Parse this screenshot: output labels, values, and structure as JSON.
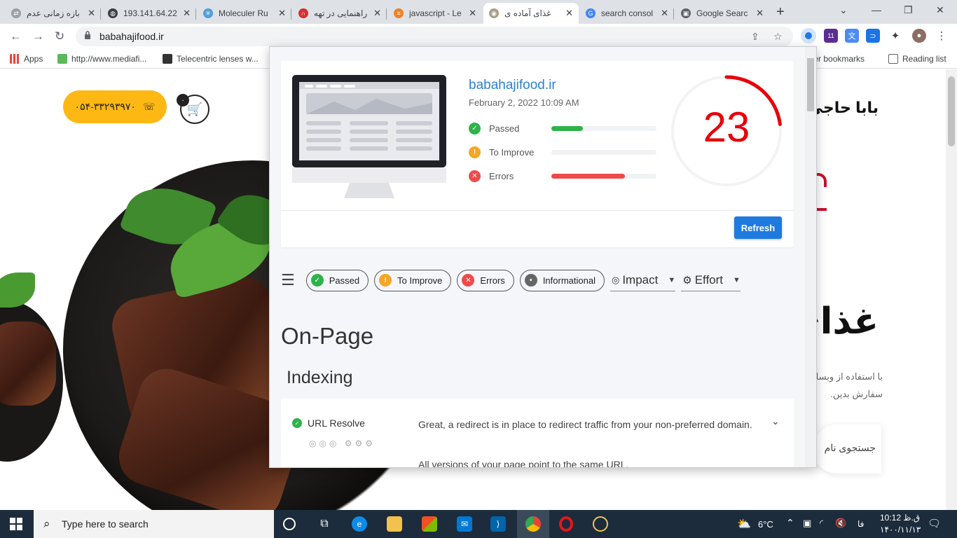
{
  "browser": {
    "tabs": [
      {
        "title": "بازه زمانی عدم",
        "color": "#5f6368"
      },
      {
        "title": "193.141.64.22",
        "color": "#5f6368"
      },
      {
        "title": "Moleculer Ru",
        "color": "#4e9fdc"
      },
      {
        "title": "راهنمایی در تهه",
        "color": "#d32f2f"
      },
      {
        "title": "javascript - Le",
        "color": "#f48024"
      },
      {
        "title": "غذای آماده ی",
        "color": "#a89f88"
      },
      {
        "title": "search consol",
        "color": "#4285f4"
      },
      {
        "title": "Google Searc",
        "color": "#5f6368"
      }
    ],
    "new_tab": "+",
    "url": "babahajifood.ir",
    "extension_badge": "11",
    "bookmarks": [
      {
        "label": "Apps"
      },
      {
        "label": "http://www.mediafi..."
      },
      {
        "label": "Telecentric lenses w..."
      }
    ],
    "other_bookmarks": "Other bookmarks",
    "reading_list": "Reading list"
  },
  "site": {
    "phone": "۰۵۴-۳۳۲۹۳۹۷۰",
    "cart_count": "۰",
    "brand": "بابا حاجی",
    "headline": "غذای",
    "desc_line1": "با استفاده از وبسا",
    "desc_line2": "سفارش بدین.",
    "search_placeholder": "جستجوی نام"
  },
  "report": {
    "site": "babahajifood.ir",
    "date": "February 2, 2022 10:09 AM",
    "score": "23",
    "score_fraction": 0.23,
    "stats": [
      {
        "label": "Passed",
        "fraction": 0.3,
        "color": "#2db34a",
        "icon": "check"
      },
      {
        "label": "To Improve",
        "fraction": 0.0,
        "color": "#f5a623",
        "icon": "!"
      },
      {
        "label": "Errors",
        "fraction": 0.7,
        "color": "#ef4a4a",
        "icon": "x"
      }
    ],
    "refresh_label": "Refresh",
    "filters": [
      {
        "label": "Passed",
        "color": "#2db34a",
        "icon": "✓"
      },
      {
        "label": "To Improve",
        "color": "#f5a623",
        "icon": "!"
      },
      {
        "label": "Errors",
        "color": "#ef4a4a",
        "icon": "✕"
      },
      {
        "label": "Informational",
        "color": "#666666",
        "icon": "•"
      }
    ],
    "impact_label": "Impact",
    "effort_label": "Effort",
    "section_title": "On-Page",
    "subsection_title": "Indexing",
    "item": {
      "name": "URL Resolve",
      "description": "Great, a redirect is in place to redirect traffic from your non-preferred domain.",
      "description2": "All versions of your page point to the same URL."
    }
  },
  "taskbar": {
    "search_placeholder": "Type here to search",
    "weather": "6°C",
    "lang": "فا",
    "time": "10:12 ق.ظ",
    "date": "۱۴۰۰/۱۱/۱۳"
  }
}
